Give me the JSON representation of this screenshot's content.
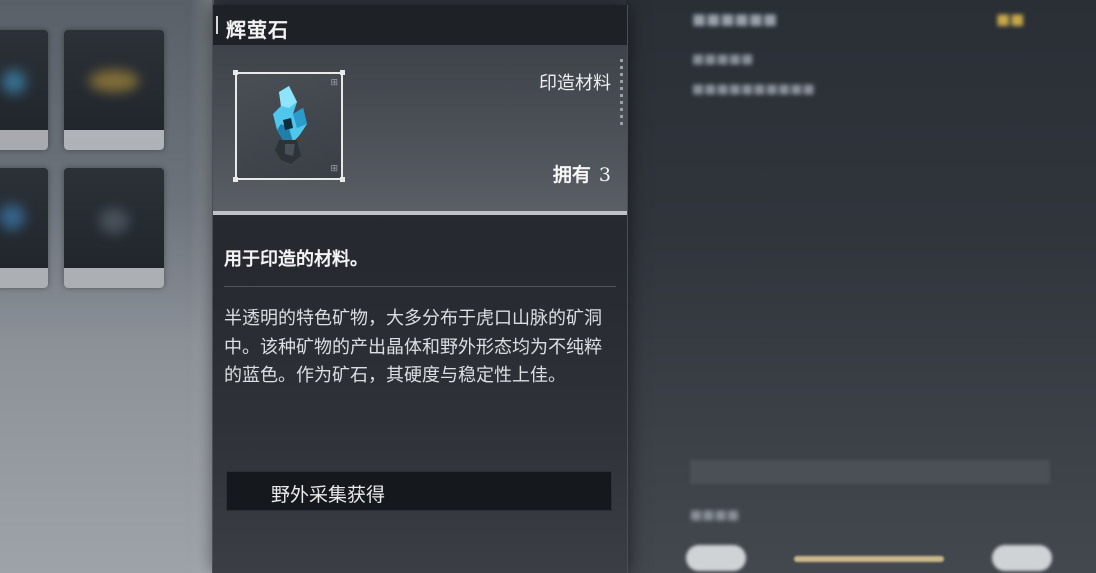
{
  "item": {
    "name": "辉萤石",
    "category": "印造材料",
    "owned_label": "拥有",
    "owned_count": "3",
    "short_description": "用于印造的材料。",
    "long_description": "半透明的特色矿物，大多分布于虎口山脉的矿洞中。该种矿物的产出晶体和野外形态均为不纯粹的蓝色。作为矿石，其硬度与稳定性上佳。",
    "icon": "crystal-icon",
    "icon_color": "#4fc6ec"
  },
  "source": {
    "label": "野外采集获得"
  },
  "colors": {
    "panel_bg": "#2a2e34",
    "header_bg": "#1e2227",
    "accent": "#bfc3c8",
    "text": "#f2f2f2"
  }
}
